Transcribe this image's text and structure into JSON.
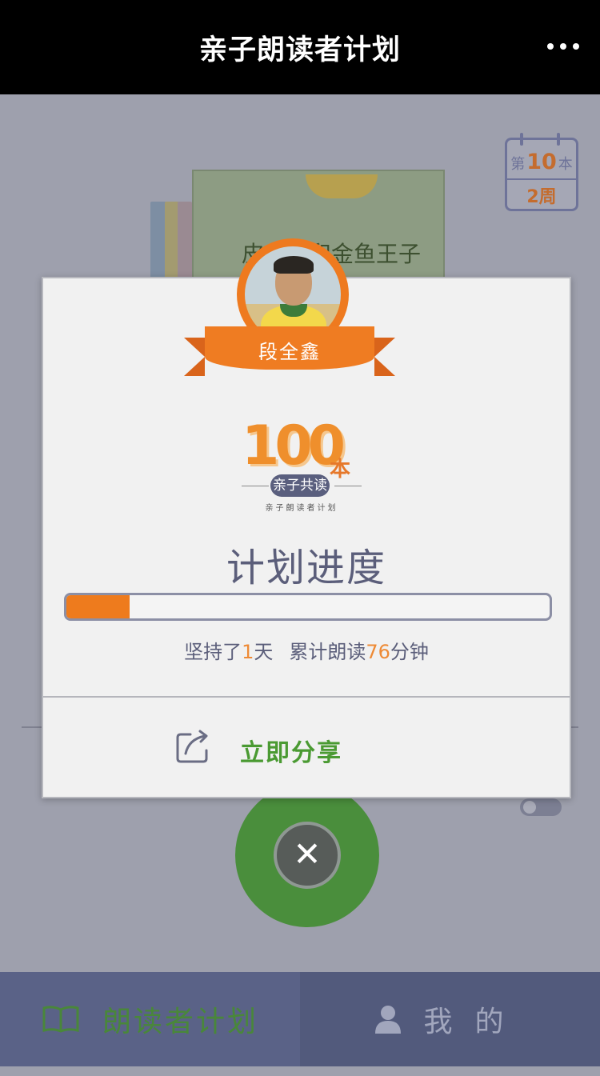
{
  "header": {
    "title": "亲子朗读者计划",
    "more_icon": "more-dots-icon"
  },
  "background": {
    "calendar": {
      "prefix": "第",
      "book_number": "10",
      "suffix": "本",
      "weeks": "2周"
    },
    "book_cover_title": "皮皮鲁和金鱼王子"
  },
  "modal": {
    "child_name": "段全鑫",
    "logo": {
      "number": "100",
      "unit": "本",
      "badge": "亲子共读",
      "subtitle": "亲子朗读者计划"
    },
    "progress_title": "计划进度",
    "progress_fraction": 0.13,
    "stats": {
      "days_prefix": "坚持了",
      "days_value": "1",
      "days_suffix": "天",
      "minutes_prefix": "累计朗读",
      "minutes_value": "76",
      "minutes_suffix": "分钟"
    },
    "share_label": "立即分享"
  },
  "tabs": [
    {
      "label": "朗读者计划",
      "icon": "open-book-icon",
      "active": true
    },
    {
      "label": "我的",
      "icon": "person-icon",
      "active": false
    }
  ],
  "colors": {
    "accent_orange": "#ee7b1d",
    "accent_green": "#4a9a32",
    "tab_bar": "#525a7c"
  }
}
